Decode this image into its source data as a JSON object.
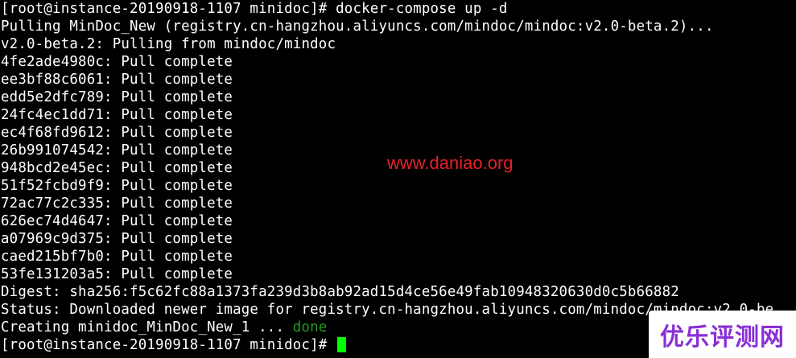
{
  "terminal": {
    "lines": [
      "[root@instance-20190918-1107 minidoc]# docker-compose up -d",
      "Pulling MinDoc_New (registry.cn-hangzhou.aliyuncs.com/mindoc/mindoc:v2.0-beta.2)...",
      "v2.0-beta.2: Pulling from mindoc/mindoc",
      "4fe2ade4980c: Pull complete",
      "ee3bf88c6061: Pull complete",
      "edd5e2dfc789: Pull complete",
      "24fc4ec1dd71: Pull complete",
      "ec4f68fd9612: Pull complete",
      "26b991074542: Pull complete",
      "948bcd2e45ec: Pull complete",
      "51f52fcbd9f9: Pull complete",
      "72ac77c2c335: Pull complete",
      "626ec74d4647: Pull complete",
      "a07969c9d375: Pull complete",
      "caed215bf7b0: Pull complete",
      "53fe131203a5: Pull complete",
      "Digest: sha256:f5c62fc88a1373fa239d3b8ab92ad15d4ce56e49fab10948320630d0c5b66882",
      "Status: Downloaded newer image for registry.cn-hangzhou.aliyuncs.com/mindoc/mindoc:v2.0-be"
    ],
    "creating_prefix": "Creating minidoc_MinDoc_New_1 ... ",
    "creating_status": "done",
    "prompt": "[root@instance-20190918-1107 minidoc]# "
  },
  "watermark": {
    "text": "www.daniao.org",
    "color": "#e8212a"
  },
  "brand": {
    "text": "优乐评测网",
    "color": "#8a2fd6"
  },
  "colors": {
    "background": "#000000",
    "foreground": "#ffffff",
    "done": "#1e9b1e",
    "cursor": "#00ff00"
  }
}
